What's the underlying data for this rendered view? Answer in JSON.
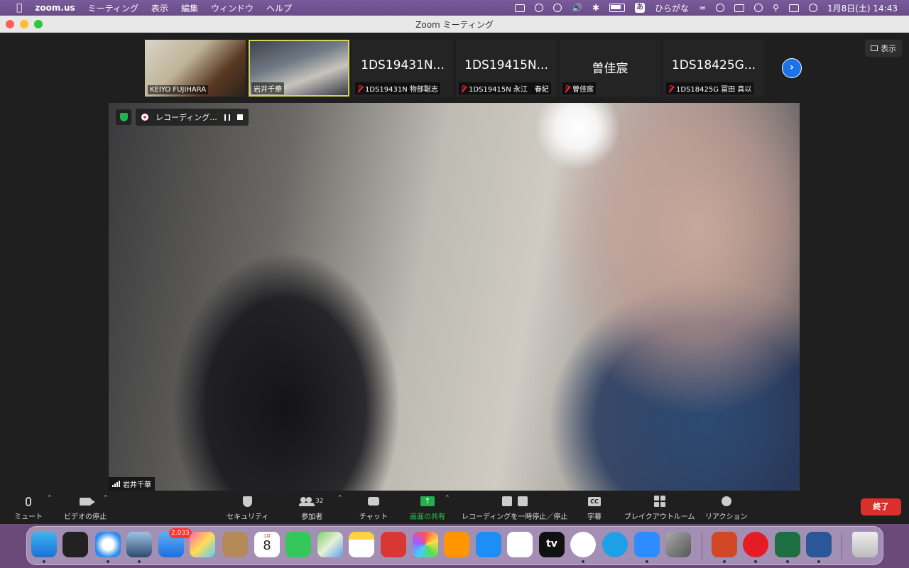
{
  "menubar": {
    "app_name": "zoom.us",
    "menus": [
      "ミーティング",
      "表示",
      "編集",
      "ウィンドウ",
      "ヘルプ"
    ],
    "input_method": "ひらがな",
    "input_method_glyph": "あ",
    "datetime": "1月8日(土)  14:43"
  },
  "window": {
    "title": "Zoom ミーティング"
  },
  "view_button": {
    "label": "表示"
  },
  "thumbnails": [
    {
      "display": "",
      "caption": "KEIYO FUJIHARA",
      "muted": false,
      "video": "vid1"
    },
    {
      "display": "",
      "caption": "岩井千華",
      "muted": false,
      "video": "vid2",
      "active": true
    },
    {
      "display": "1DS19431N...",
      "caption": "1DS19431N 物部聡志",
      "muted": true
    },
    {
      "display": "1DS19415N...",
      "caption": "1DS19415N 永江　春紀",
      "muted": true
    },
    {
      "display": "曽佳宸",
      "caption": "曽佳宸",
      "muted": true
    },
    {
      "display": "1DS18425G...",
      "caption": "1DS18425G 冨田 真以",
      "muted": true
    }
  ],
  "recording": {
    "label": "レコーディング..."
  },
  "active_speaker": {
    "name": "岩井千華"
  },
  "toolbar": {
    "mute": "ミュート",
    "stop_video": "ビデオの停止",
    "security": "セキュリティ",
    "participants": "参加者",
    "participant_count": "32",
    "chat": "チャット",
    "share": "画面の共有",
    "recording_control": "レコーディングを一時停止／停止",
    "captions": "字幕",
    "captions_glyph": "CC",
    "breakout": "ブレイクアウトルーム",
    "reactions": "リアクション",
    "end": "終了"
  },
  "dock": {
    "mail_badge": "2,033",
    "calendar_month": "1月",
    "calendar_day": "8",
    "tv_label": "tv"
  }
}
